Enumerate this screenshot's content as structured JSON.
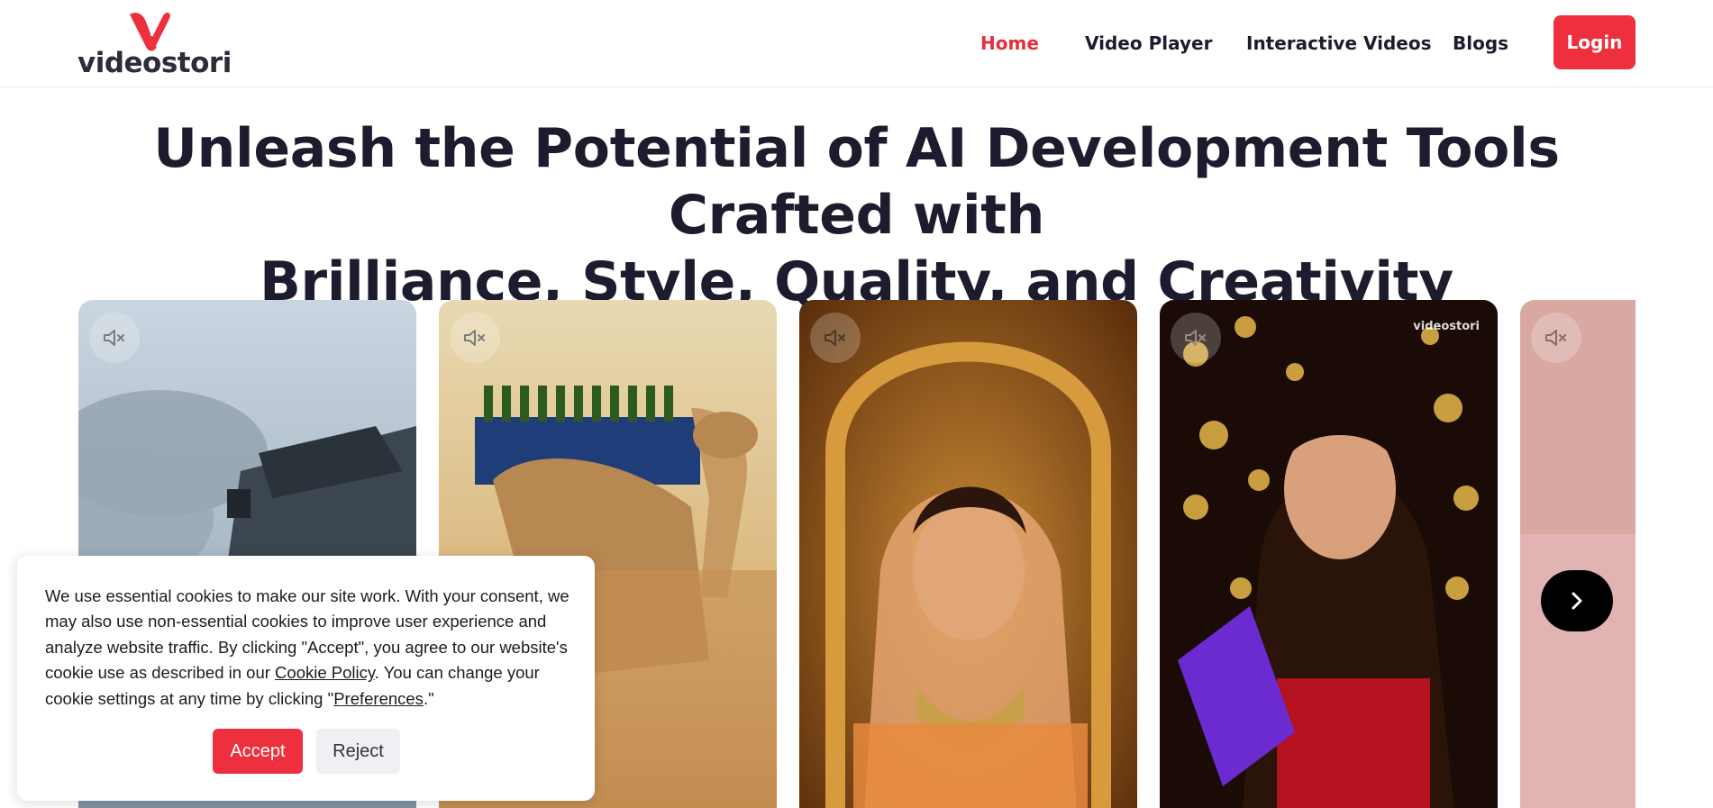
{
  "brand": {
    "name": "videostori",
    "accent_color": "#ee2f3d"
  },
  "nav": {
    "items": [
      {
        "label": "Home",
        "active": true
      },
      {
        "label": "Video Player",
        "active": false
      },
      {
        "label": "Interactive Videos",
        "active": false
      },
      {
        "label": "Blogs",
        "active": false
      }
    ],
    "login_label": "Login"
  },
  "hero": {
    "title_line1": "Unleash the Potential of AI Development Tools Crafted with",
    "title_line2": "Brilliance, Style, Quality, and Creativity"
  },
  "carousel": {
    "cards": [
      {
        "subject": "pickup truck in dust",
        "muted": true
      },
      {
        "subject": "camel carrying soda crates",
        "muted": true
      },
      {
        "subject": "bride with jewellery",
        "muted": true
      },
      {
        "subject": "woman holding chocolate bar",
        "muted": true,
        "watermark": "videostori"
      },
      {
        "subject": "partial card",
        "muted": true
      }
    ],
    "icons": {
      "mute": "muted-speaker-icon",
      "next": "chevron-right-icon"
    }
  },
  "cookie": {
    "text_part1": "We use essential cookies to make our site work. With your consent, we may also use non-essential cookies to improve user experience and analyze website traffic. By clicking \"Accept\", you agree to our website's cookie use as described in our ",
    "cookie_policy_link": "Cookie Policy",
    "text_part2": ". You can change your cookie settings at any time by clicking \"",
    "preferences_link": "Preferences",
    "text_part3": ".\"",
    "accept_label": "Accept",
    "reject_label": "Reject"
  }
}
